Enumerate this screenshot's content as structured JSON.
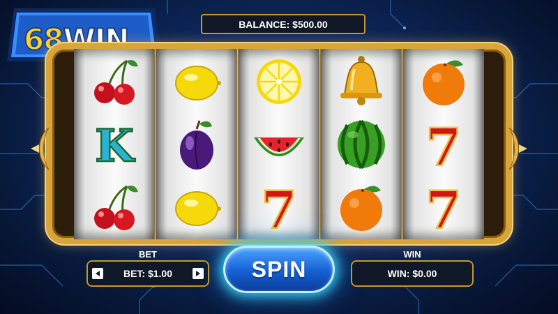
{
  "brand": {
    "logo_number": "68",
    "logo_word": "WIN"
  },
  "balance": {
    "label": "BALANCE: $500.00"
  },
  "reels": [
    [
      "cherries",
      "letter-k",
      "cherries"
    ],
    [
      "lemon",
      "plum",
      "lemon"
    ],
    [
      "lemon-slice",
      "watermelon-slice",
      "seven"
    ],
    [
      "bell",
      "watermelon",
      "orange"
    ],
    [
      "orange",
      "seven",
      "seven"
    ]
  ],
  "controls": {
    "bet_heading": "BET",
    "bet_value": "BET: $1.00",
    "spin_label": "SPIN",
    "win_heading": "WIN",
    "win_value": "WIN: $0.00"
  },
  "colors": {
    "accent_gold": "#d9a53a",
    "spin_blue": "#1560d4",
    "logo_yellow": "#ffd21f"
  }
}
